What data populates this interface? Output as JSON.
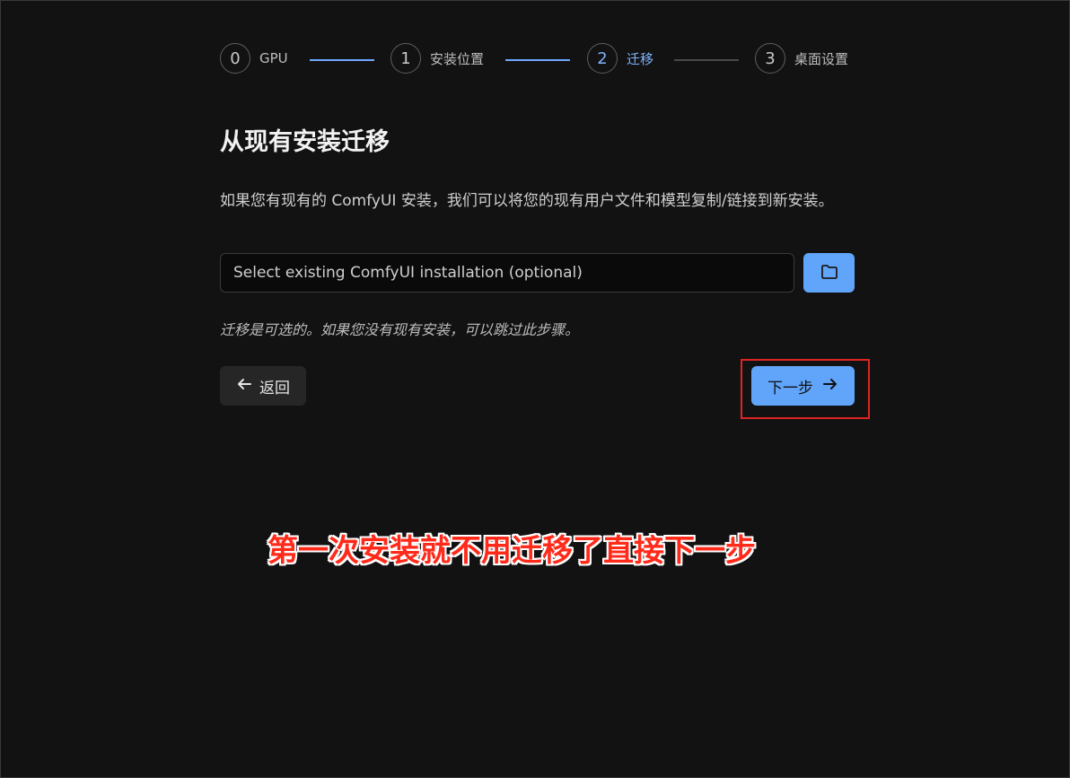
{
  "stepper": {
    "steps": [
      {
        "number": "0",
        "label": "GPU",
        "state": "done"
      },
      {
        "number": "1",
        "label": "安装位置",
        "state": "done"
      },
      {
        "number": "2",
        "label": "迁移",
        "state": "active"
      },
      {
        "number": "3",
        "label": "桌面设置",
        "state": "todo"
      }
    ]
  },
  "main": {
    "title": "从现有安装迁移",
    "description": "如果您有现有的 ComfyUI 安装，我们可以将您的现有用户文件和模型复制/链接到新安装。",
    "path_input": {
      "value": "",
      "placeholder": "Select existing ComfyUI installation (optional)"
    },
    "browse_icon": "folder-icon",
    "note": "迁移是可选的。如果您没有现有安装，可以跳过此步骤。",
    "back_label": "返回",
    "next_label": "下一步"
  },
  "annotation": {
    "text": "第一次安装就不用迁移了直接下一步",
    "color": "#ff2a1a",
    "box_color": "#e02424"
  },
  "colors": {
    "accent": "#60a5fa",
    "background": "#121212"
  }
}
